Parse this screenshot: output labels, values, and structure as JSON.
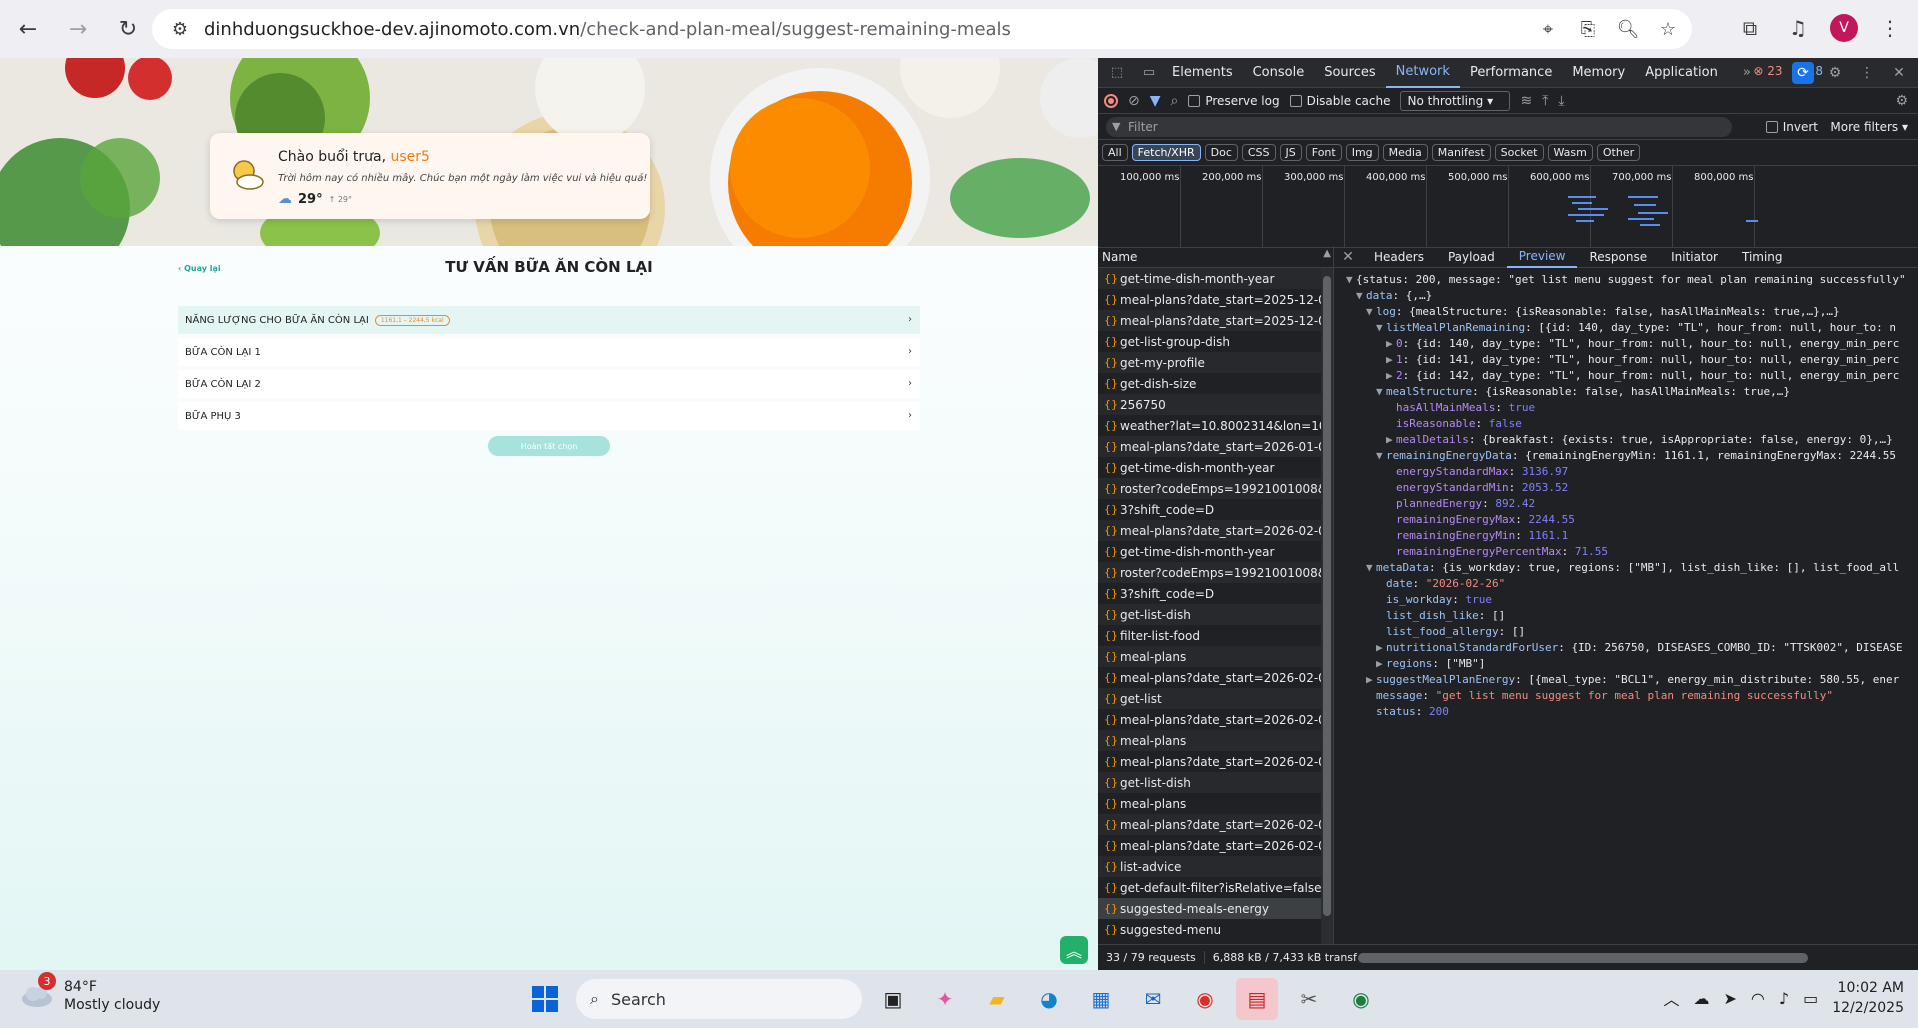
{
  "browser": {
    "url_host": "dinhduongsuckhoe-dev.ajinomoto.com.vn",
    "url_path": "/check-and-plan-meal/suggest-remaining-meals",
    "profile_initial": "V"
  },
  "page": {
    "greeting_prefix": "Chào buổi trưa,",
    "greeting_user": "user5",
    "greeting_sub": "Trời hôm nay có nhiều mây. Chúc bạn một ngày làm việc vui và hiệu quả!",
    "weather_temp": "29°",
    "weather_range": "↑ 29°",
    "back_label": "Quay lại",
    "title": "TƯ VẤN BỮA ĂN CÒN LẠI",
    "rows": [
      {
        "label": "NĂNG LƯỢNG CHO BỮA ĂN CÒN LẠI",
        "badge": "1161,1 – 2244,5 kcal"
      },
      {
        "label": "BỮA CÒN LẠI 1"
      },
      {
        "label": "BỮA CÒN LẠI 2"
      },
      {
        "label": "BỮA PHỤ 3"
      }
    ],
    "finish_button": "Hoàn tất chọn"
  },
  "devtools": {
    "tabs": [
      "Elements",
      "Console",
      "Sources",
      "Network",
      "Performance",
      "Memory",
      "Application"
    ],
    "active_tab": "Network",
    "error_count": "23",
    "info_count": "18",
    "preserve_log": "Preserve log",
    "disable_cache": "Disable cache",
    "throttling": "No throttling",
    "filter_placeholder": "Filter",
    "invert": "Invert",
    "more_filters": "More filters",
    "types": [
      "All",
      "Fetch/XHR",
      "Doc",
      "CSS",
      "JS",
      "Font",
      "Img",
      "Media",
      "Manifest",
      "Socket",
      "Wasm",
      "Other"
    ],
    "active_type": "Fetch/XHR",
    "timeline_labels": [
      "100,000 ms",
      "200,000 ms",
      "300,000 ms",
      "400,000 ms",
      "500,000 ms",
      "600,000 ms",
      "700,000 ms",
      "800,000 ms"
    ],
    "name_header": "Name",
    "requests": [
      "get-time-dish-month-year",
      "meal-plans?date_start=2025-12-01&...",
      "meal-plans?date_start=2025-12-01&...",
      "get-list-group-dish",
      "get-my-profile",
      "get-dish-size",
      "256750",
      "weather?lat=10.8002314&lon=106.6...",
      "meal-plans?date_start=2026-01-01&...",
      "get-time-dish-month-year",
      "roster?codeEmps=19921001008&dat...",
      "3?shift_code=D",
      "meal-plans?date_start=2026-02-01&...",
      "get-time-dish-month-year",
      "roster?codeEmps=19921001008&dat...",
      "3?shift_code=D",
      "get-list-dish",
      "filter-list-food",
      "meal-plans",
      "meal-plans?date_start=2026-02-01&...",
      "get-list",
      "meal-plans?date_start=2026-02-01&...",
      "meal-plans",
      "meal-plans?date_start=2026-02-01&...",
      "get-list-dish",
      "meal-plans",
      "meal-plans?date_start=2026-02-01&...",
      "meal-plans?date_start=2026-02-01&...",
      "list-advice",
      "get-default-filter?isRelative=false",
      "suggested-meals-energy",
      "suggested-menu"
    ],
    "selected_request": "suggested-meals-energy",
    "detail_tabs": [
      "Headers",
      "Payload",
      "Preview",
      "Response",
      "Initiator",
      "Timing"
    ],
    "active_detail_tab": "Preview",
    "preview_lines": [
      {
        "indent": 0,
        "tri": "▼",
        "text": "{status: 200, message: \"get list menu suggest for meal plan remaining successfully\""
      },
      {
        "indent": 1,
        "tri": "▼",
        "key": "data",
        "text": "{,…}"
      },
      {
        "indent": 2,
        "tri": "▼",
        "key": "log",
        "text": "{mealStructure: {isReasonable: false, hasAllMainMeals: true,…},…}"
      },
      {
        "indent": 3,
        "tri": "▼",
        "key": "listMealPlanRemaining",
        "text": "[{id: 140, day_type: \"TL\", hour_from: null, hour_to: n"
      },
      {
        "indent": 4,
        "tri": "▶",
        "key": "0",
        "text": "{id: 140, day_type: \"TL\", hour_from: null, hour_to: null, energy_min_perc"
      },
      {
        "indent": 4,
        "tri": "▶",
        "key": "1",
        "text": "{id: 141, day_type: \"TL\", hour_from: null, hour_to: null, energy_min_perc"
      },
      {
        "indent": 4,
        "tri": "▶",
        "key": "2",
        "text": "{id: 142, day_type: \"TL\", hour_from: null, hour_to: null, energy_min_perc"
      },
      {
        "indent": 3,
        "tri": "▼",
        "key": "mealStructure",
        "text": "{isReasonable: false, hasAllMainMeals: true,…}"
      },
      {
        "indent": 4,
        "tri": "",
        "key": "hasAllMainMeals",
        "value": "true",
        "vtype": "b"
      },
      {
        "indent": 4,
        "tri": "",
        "key": "isReasonable",
        "value": "false",
        "vtype": "b"
      },
      {
        "indent": 4,
        "tri": "▶",
        "key": "mealDetails",
        "text": "{breakfast: {exists: true, isAppropriate: false, energy: 0},…}"
      },
      {
        "indent": 3,
        "tri": "▼",
        "key": "remainingEnergyData",
        "text": "{remainingEnergyMin: 1161.1, remainingEnergyMax: 2244.55"
      },
      {
        "indent": 4,
        "tri": "",
        "key": "energyStandardMax",
        "value": "3136.97",
        "vtype": "n"
      },
      {
        "indent": 4,
        "tri": "",
        "key": "energyStandardMin",
        "value": "2053.52",
        "vtype": "n"
      },
      {
        "indent": 4,
        "tri": "",
        "key": "plannedEnergy",
        "value": "892.42",
        "vtype": "n"
      },
      {
        "indent": 4,
        "tri": "",
        "key": "remainingEnergyMax",
        "value": "2244.55",
        "vtype": "n"
      },
      {
        "indent": 4,
        "tri": "",
        "key": "remainingEnergyMin",
        "value": "1161.1",
        "vtype": "n"
      },
      {
        "indent": 4,
        "tri": "",
        "key": "remainingEnergyPercentMax",
        "value": "71.55",
        "vtype": "n"
      },
      {
        "indent": 2,
        "tri": "▼",
        "key": "metaData",
        "text": "{is_workday: true, regions: [\"MB\"], list_dish_like: [], list_food_all"
      },
      {
        "indent": 3,
        "tri": "",
        "key": "date",
        "value": "\"2026-02-26\"",
        "vtype": "s"
      },
      {
        "indent": 3,
        "tri": "",
        "key": "is_workday",
        "value": "true",
        "vtype": "b"
      },
      {
        "indent": 3,
        "tri": "",
        "key": "list_dish_like",
        "text": "[]"
      },
      {
        "indent": 3,
        "tri": "",
        "key": "list_food_allergy",
        "text": "[]"
      },
      {
        "indent": 3,
        "tri": "▶",
        "key": "nutritionalStandardForUser",
        "text": "{ID: 256750, DISEASES_COMBO_ID: \"TTSK002\", DISEASE"
      },
      {
        "indent": 3,
        "tri": "▶",
        "key": "regions",
        "text": "[\"MB\"]"
      },
      {
        "indent": 2,
        "tri": "▶",
        "key": "suggestMealPlanEnergy",
        "text": "[{meal_type: \"BCL1\", energy_min_distribute: 580.55, ener"
      },
      {
        "indent": 2,
        "tri": "",
        "key": "message",
        "value": "\"get list menu suggest for meal plan remaining successfully\"",
        "vtype": "s"
      },
      {
        "indent": 2,
        "tri": "",
        "key": "status",
        "value": "200",
        "vtype": "n"
      }
    ],
    "status_requests": "33 / 79 requests",
    "status_transfer": "6,888 kB / 7,433 kB transf"
  },
  "taskbar": {
    "weather_badge": "3",
    "weather_temp": "84°F",
    "weather_desc": "Mostly cloudy",
    "search_label": "Search",
    "time": "10:02 AM",
    "date": "12/2/2025"
  }
}
